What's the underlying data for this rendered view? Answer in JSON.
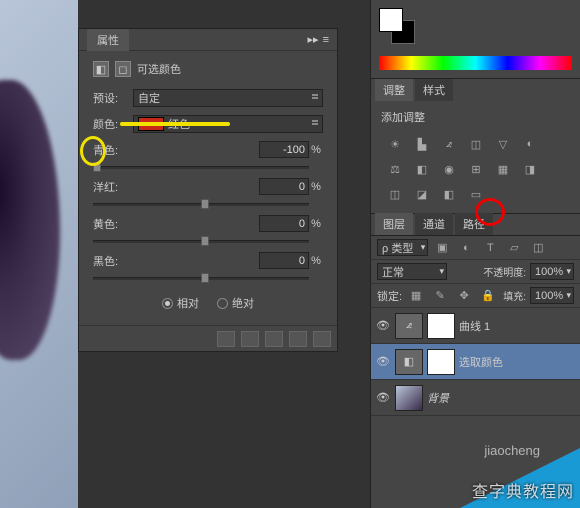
{
  "props_panel": {
    "tab": "属性",
    "title": "可选颜色",
    "preset_label": "预设:",
    "preset_value": "自定",
    "color_label": "颜色:",
    "color_value": "红色",
    "sliders": {
      "cyan": {
        "label": "青色:",
        "value": "-100",
        "pct": "%"
      },
      "magenta": {
        "label": "洋红:",
        "value": "0",
        "pct": "%"
      },
      "yellow": {
        "label": "黄色:",
        "value": "0",
        "pct": "%"
      },
      "black": {
        "label": "黑色:",
        "value": "0",
        "pct": "%"
      }
    },
    "radio_relative": "相对",
    "radio_absolute": "绝对"
  },
  "adjustments": {
    "tab1": "调整",
    "tab2": "样式",
    "title": "添加调整"
  },
  "layers": {
    "tab1": "图层",
    "tab2": "通道",
    "tab3": "路径",
    "filter_label": "ρ 类型",
    "blend_mode": "正常",
    "opacity_label": "不透明度:",
    "opacity_value": "100%",
    "lock_label": "锁定:",
    "fill_label": "填充:",
    "fill_value": "100%",
    "items": [
      {
        "name": "曲线 1"
      },
      {
        "name": "选取颜色"
      },
      {
        "name": "背景"
      }
    ]
  },
  "watermark1": "查字典教程网",
  "watermark2": "jiaocheng"
}
